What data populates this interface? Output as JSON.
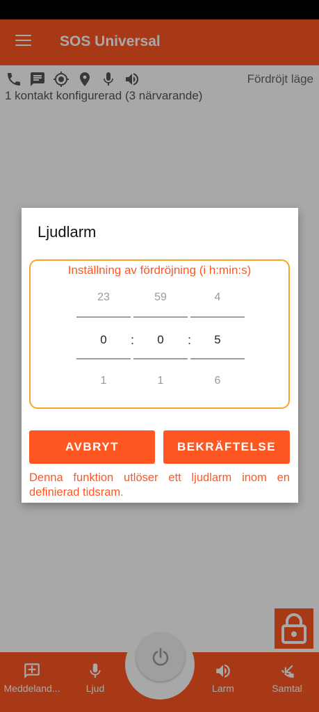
{
  "app": {
    "title": "SOS Universal"
  },
  "status": {
    "delay_mode": "Fördröjt läge",
    "contact_info": "1 kontakt konfigurerad (3 närvarande)",
    "icons": [
      "phone-icon",
      "message-icon",
      "gps-icon",
      "location-pin-icon",
      "microphone-icon",
      "speaker-icon"
    ]
  },
  "dialog": {
    "title": "Ljudlarm",
    "picker_label": "Inställning av fördröjning (i h:min:s)",
    "hours": {
      "prev": "23",
      "current": "0",
      "next": "1"
    },
    "minutes": {
      "prev": "59",
      "current": "0",
      "next": "1"
    },
    "seconds": {
      "prev": "4",
      "current": "5",
      "next": "6"
    },
    "separator": ":",
    "cancel_label": "AVBRYT",
    "confirm_label": "BEKRÄFTELSE",
    "description": "Denna funktion utlöser ett ljudlarm inom en definierad tidsram."
  },
  "bottom_nav": {
    "message_label": "Meddeland...",
    "sound_label": "Ljud",
    "alarm_label": "Larm",
    "call_label": "Samtal"
  },
  "colors": {
    "accent": "#ff5722",
    "picker_border": "#f5a623"
  }
}
